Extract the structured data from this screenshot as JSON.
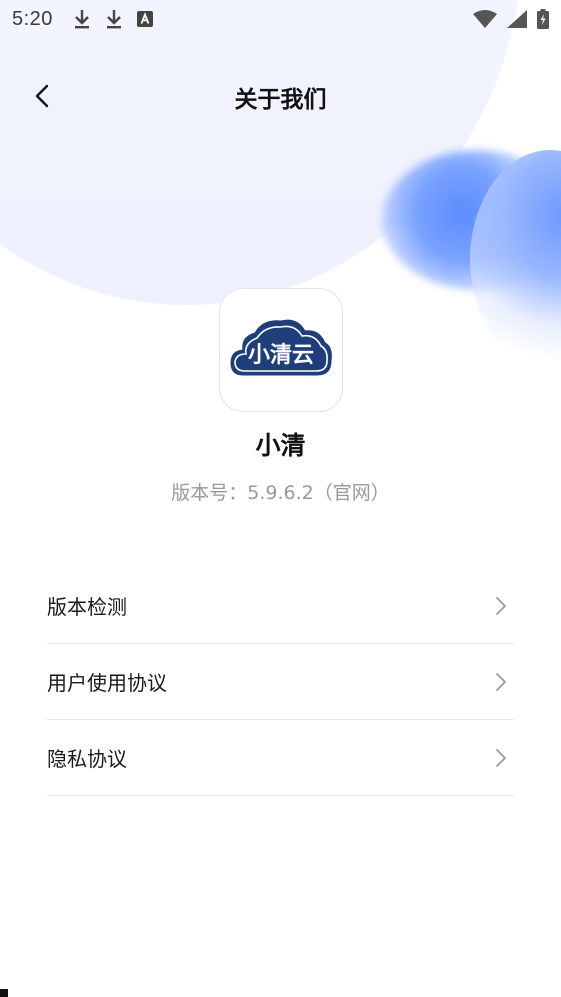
{
  "status_bar": {
    "time": "5:20",
    "left_icons": [
      "download-icon",
      "download-icon",
      "app-notification-icon"
    ],
    "right_icons": [
      "wifi-icon",
      "signal-icon",
      "battery-charging-icon"
    ]
  },
  "header": {
    "title": "关于我们",
    "back_icon": "chevron-left-icon"
  },
  "app": {
    "logo_text": "小清云",
    "name": "小清",
    "version": "版本号：5.9.6.2（官网）"
  },
  "menu": {
    "items": [
      {
        "label": "版本检测"
      },
      {
        "label": "用户使用协议"
      },
      {
        "label": "隐私协议"
      }
    ]
  },
  "colors": {
    "accent": "#5b8cff",
    "logo_blue": "#1f3f7a",
    "title_text": "#111111",
    "secondary_text": "#999999",
    "divider": "#e8e8e8"
  }
}
